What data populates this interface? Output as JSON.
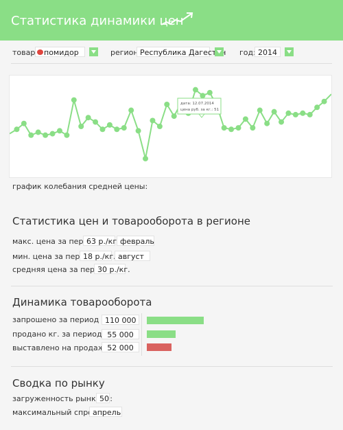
{
  "header": {
    "title": "Статистика динамики цен",
    "icon": "trend-up-icon"
  },
  "filters": {
    "product_label": "товар:",
    "product_value": "помидор",
    "product_icon": "tomato-icon",
    "region_label": "регион:",
    "region_value": "Республика Дагестан",
    "year_label": "год:",
    "year_value": "2014"
  },
  "chart_caption": "график колебания средней цены:",
  "tooltip": {
    "date": "дата: 12.07.2014",
    "price": "цена руб. за кг.: 51"
  },
  "chart_data": {
    "type": "line",
    "color": "#8ade86",
    "x": [
      1,
      2,
      3,
      4,
      5,
      6,
      7,
      8,
      9,
      10,
      11,
      12,
      13,
      14,
      15,
      16,
      17,
      18,
      19,
      20,
      21,
      22,
      23,
      24,
      25,
      26,
      27,
      28,
      29,
      30,
      31,
      32,
      33,
      34,
      35,
      36,
      37,
      38,
      39,
      40,
      41,
      42,
      43,
      44,
      45,
      46
    ],
    "values": [
      25,
      28,
      32,
      24,
      26,
      24,
      25,
      27,
      24,
      48,
      30,
      36,
      33,
      28,
      31,
      28,
      29,
      41,
      27,
      8,
      34,
      30,
      45,
      37,
      46,
      39,
      55,
      51,
      53,
      44,
      29,
      28,
      29,
      35,
      29,
      41,
      32,
      40,
      33,
      39,
      38,
      39,
      38,
      43,
      47,
      52
    ]
  },
  "price_section": {
    "title": "Статистика цен и товарооборота в регионе",
    "max_label": "макс. цена за период:",
    "max_value": "63 р./кг.",
    "max_month": "февраль",
    "min_label": "мин. цена за период:",
    "min_value": "18 р./кг.",
    "min_month": "август",
    "avg_label": "средняя цена за период:",
    "avg_value": "30 р./кг."
  },
  "turnover_section": {
    "title": "Динамика товарооборота",
    "rows": [
      {
        "label": "запрошено  за период кг.:",
        "value": "110 000",
        "fraction": 1.0,
        "color": "#8ade86"
      },
      {
        "label": "продано кг. за период:",
        "value": "55 000",
        "fraction": 0.5,
        "color": "#8ade86"
      },
      {
        "label": "выставлено на продажу кг:",
        "value": "52 000",
        "fraction": 0.43,
        "color": "#d9625f"
      }
    ]
  },
  "market_section": {
    "title": "Сводка по рынку",
    "load_label": "загруженность рынка %:",
    "load_value": "50",
    "demand_label": "максимальный спрос:",
    "demand_value": "апрель"
  }
}
